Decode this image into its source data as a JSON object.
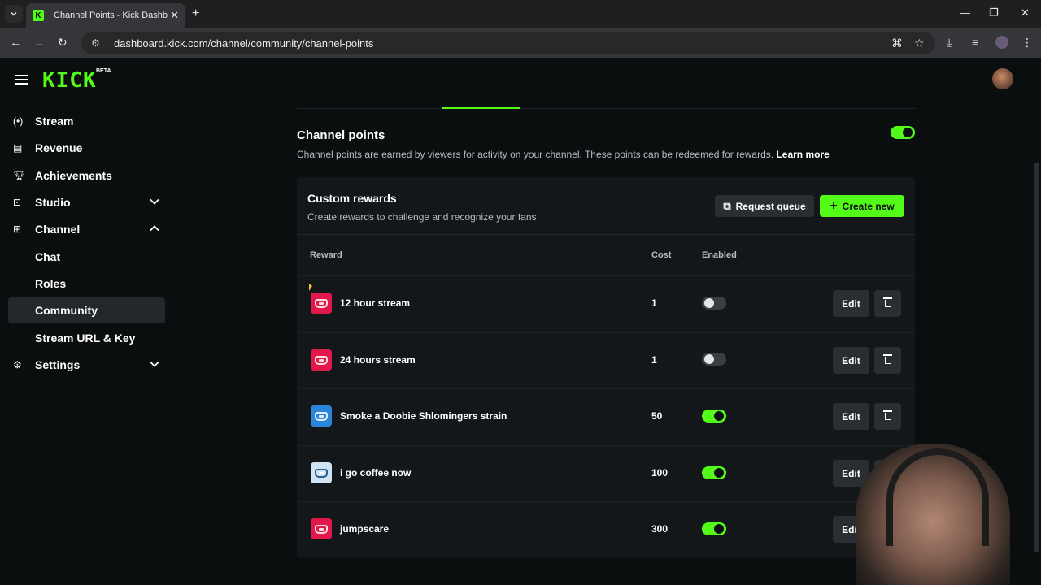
{
  "browser": {
    "tab_title": "Channel Points - Kick Dashboard",
    "url": "dashboard.kick.com/channel/community/channel-points"
  },
  "header": {
    "logo_text": "KICK",
    "logo_badge": "BETA"
  },
  "sidebar": {
    "items": [
      {
        "label": "Stream",
        "icon": "stream-icon"
      },
      {
        "label": "Revenue",
        "icon": "revenue-icon"
      },
      {
        "label": "Achievements",
        "icon": "trophy-icon"
      },
      {
        "label": "Studio",
        "icon": "studio-icon",
        "expandable": true,
        "expanded": false
      },
      {
        "label": "Channel",
        "icon": "channel-icon",
        "expandable": true,
        "expanded": true
      },
      {
        "label": "Chat",
        "sub": true
      },
      {
        "label": "Roles",
        "sub": true
      },
      {
        "label": "Community",
        "sub": true,
        "active": true
      },
      {
        "label": "Stream URL & Key",
        "sub": true
      },
      {
        "label": "Settings",
        "icon": "gear-icon",
        "expandable": true,
        "expanded": false
      }
    ]
  },
  "channel_points": {
    "title": "Channel points",
    "description": "Channel points are earned by viewers for activity on your channel. These points can be redeemed for rewards.",
    "learn_more": "Learn more",
    "enabled": true
  },
  "custom_rewards": {
    "title": "Custom rewards",
    "subtitle": "Create rewards to challenge and recognize your fans",
    "request_queue_label": "Request queue",
    "create_new_label": "Create new",
    "columns": {
      "reward": "Reward",
      "cost": "Cost",
      "enabled": "Enabled"
    },
    "edit_label": "Edit",
    "rows": [
      {
        "name": "12 hour stream",
        "cost": "1",
        "enabled": false,
        "color": "#e0194a"
      },
      {
        "name": "24 hours stream",
        "cost": "1",
        "enabled": false,
        "color": "#e0194a"
      },
      {
        "name": "Smoke a Doobie Shlomingers strain",
        "cost": "50",
        "enabled": true,
        "color": "#2b86d9"
      },
      {
        "name": "i go coffee now",
        "cost": "100",
        "enabled": true,
        "color": "#cfe3f5"
      },
      {
        "name": "jumpscare",
        "cost": "300",
        "enabled": true,
        "color": "#e0194a"
      }
    ]
  },
  "colors": {
    "accent": "#53fc18",
    "background": "#0b0e0f",
    "panel": "#141719"
  }
}
